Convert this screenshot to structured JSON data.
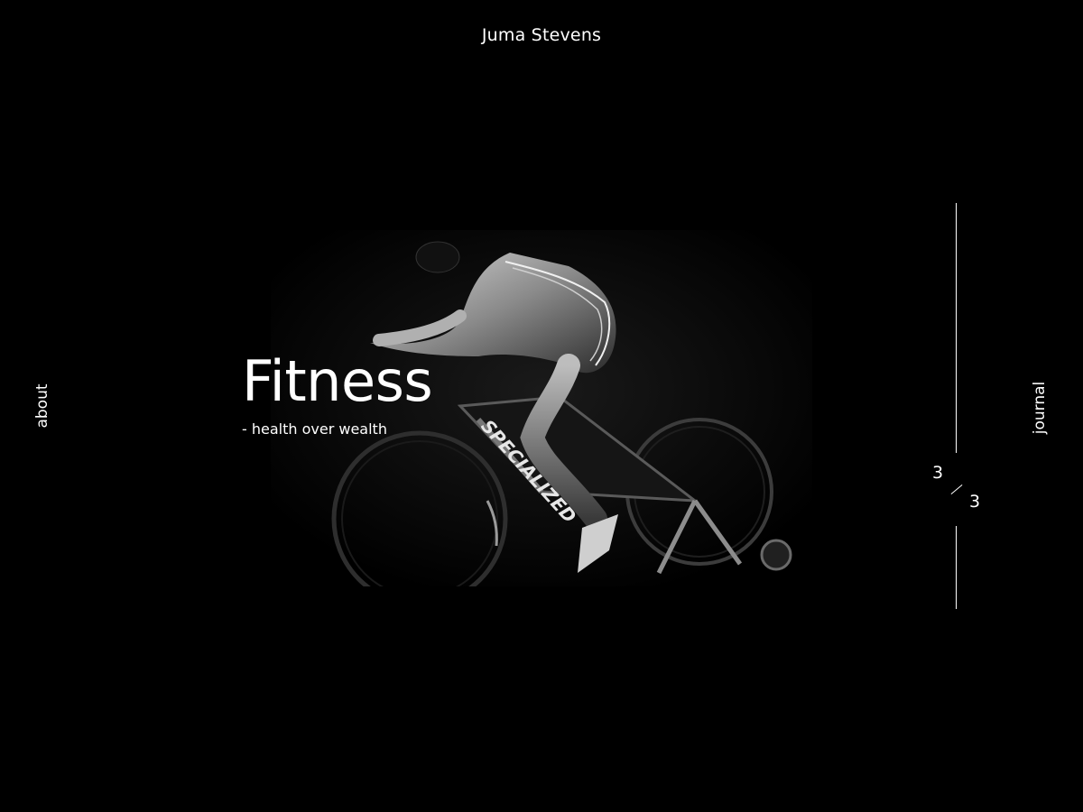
{
  "header": {
    "site_title": "Juma Stevens"
  },
  "nav": {
    "left_label": "about",
    "right_label": "journal"
  },
  "hero": {
    "title": "Fitness",
    "subtitle": "- health over wealth",
    "image_subject": "cyclist-on-bike-trainer",
    "bike_brand": "SPECIALIZED"
  },
  "slider": {
    "current": "3",
    "total": "3"
  },
  "colors": {
    "background": "#000000",
    "text": "#ffffff",
    "rail": "#ffffff"
  }
}
